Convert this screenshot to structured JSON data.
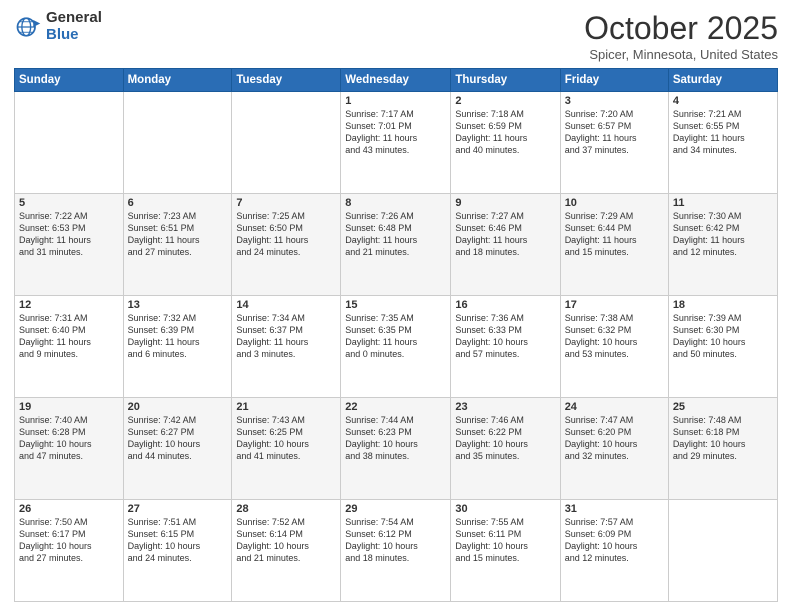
{
  "header": {
    "logo_general": "General",
    "logo_blue": "Blue",
    "title": "October 2025",
    "location": "Spicer, Minnesota, United States"
  },
  "days_of_week": [
    "Sunday",
    "Monday",
    "Tuesday",
    "Wednesday",
    "Thursday",
    "Friday",
    "Saturday"
  ],
  "weeks": [
    [
      {
        "day": "",
        "info": ""
      },
      {
        "day": "",
        "info": ""
      },
      {
        "day": "",
        "info": ""
      },
      {
        "day": "1",
        "info": "Sunrise: 7:17 AM\nSunset: 7:01 PM\nDaylight: 11 hours\nand 43 minutes."
      },
      {
        "day": "2",
        "info": "Sunrise: 7:18 AM\nSunset: 6:59 PM\nDaylight: 11 hours\nand 40 minutes."
      },
      {
        "day": "3",
        "info": "Sunrise: 7:20 AM\nSunset: 6:57 PM\nDaylight: 11 hours\nand 37 minutes."
      },
      {
        "day": "4",
        "info": "Sunrise: 7:21 AM\nSunset: 6:55 PM\nDaylight: 11 hours\nand 34 minutes."
      }
    ],
    [
      {
        "day": "5",
        "info": "Sunrise: 7:22 AM\nSunset: 6:53 PM\nDaylight: 11 hours\nand 31 minutes."
      },
      {
        "day": "6",
        "info": "Sunrise: 7:23 AM\nSunset: 6:51 PM\nDaylight: 11 hours\nand 27 minutes."
      },
      {
        "day": "7",
        "info": "Sunrise: 7:25 AM\nSunset: 6:50 PM\nDaylight: 11 hours\nand 24 minutes."
      },
      {
        "day": "8",
        "info": "Sunrise: 7:26 AM\nSunset: 6:48 PM\nDaylight: 11 hours\nand 21 minutes."
      },
      {
        "day": "9",
        "info": "Sunrise: 7:27 AM\nSunset: 6:46 PM\nDaylight: 11 hours\nand 18 minutes."
      },
      {
        "day": "10",
        "info": "Sunrise: 7:29 AM\nSunset: 6:44 PM\nDaylight: 11 hours\nand 15 minutes."
      },
      {
        "day": "11",
        "info": "Sunrise: 7:30 AM\nSunset: 6:42 PM\nDaylight: 11 hours\nand 12 minutes."
      }
    ],
    [
      {
        "day": "12",
        "info": "Sunrise: 7:31 AM\nSunset: 6:40 PM\nDaylight: 11 hours\nand 9 minutes."
      },
      {
        "day": "13",
        "info": "Sunrise: 7:32 AM\nSunset: 6:39 PM\nDaylight: 11 hours\nand 6 minutes."
      },
      {
        "day": "14",
        "info": "Sunrise: 7:34 AM\nSunset: 6:37 PM\nDaylight: 11 hours\nand 3 minutes."
      },
      {
        "day": "15",
        "info": "Sunrise: 7:35 AM\nSunset: 6:35 PM\nDaylight: 11 hours\nand 0 minutes."
      },
      {
        "day": "16",
        "info": "Sunrise: 7:36 AM\nSunset: 6:33 PM\nDaylight: 10 hours\nand 57 minutes."
      },
      {
        "day": "17",
        "info": "Sunrise: 7:38 AM\nSunset: 6:32 PM\nDaylight: 10 hours\nand 53 minutes."
      },
      {
        "day": "18",
        "info": "Sunrise: 7:39 AM\nSunset: 6:30 PM\nDaylight: 10 hours\nand 50 minutes."
      }
    ],
    [
      {
        "day": "19",
        "info": "Sunrise: 7:40 AM\nSunset: 6:28 PM\nDaylight: 10 hours\nand 47 minutes."
      },
      {
        "day": "20",
        "info": "Sunrise: 7:42 AM\nSunset: 6:27 PM\nDaylight: 10 hours\nand 44 minutes."
      },
      {
        "day": "21",
        "info": "Sunrise: 7:43 AM\nSunset: 6:25 PM\nDaylight: 10 hours\nand 41 minutes."
      },
      {
        "day": "22",
        "info": "Sunrise: 7:44 AM\nSunset: 6:23 PM\nDaylight: 10 hours\nand 38 minutes."
      },
      {
        "day": "23",
        "info": "Sunrise: 7:46 AM\nSunset: 6:22 PM\nDaylight: 10 hours\nand 35 minutes."
      },
      {
        "day": "24",
        "info": "Sunrise: 7:47 AM\nSunset: 6:20 PM\nDaylight: 10 hours\nand 32 minutes."
      },
      {
        "day": "25",
        "info": "Sunrise: 7:48 AM\nSunset: 6:18 PM\nDaylight: 10 hours\nand 29 minutes."
      }
    ],
    [
      {
        "day": "26",
        "info": "Sunrise: 7:50 AM\nSunset: 6:17 PM\nDaylight: 10 hours\nand 27 minutes."
      },
      {
        "day": "27",
        "info": "Sunrise: 7:51 AM\nSunset: 6:15 PM\nDaylight: 10 hours\nand 24 minutes."
      },
      {
        "day": "28",
        "info": "Sunrise: 7:52 AM\nSunset: 6:14 PM\nDaylight: 10 hours\nand 21 minutes."
      },
      {
        "day": "29",
        "info": "Sunrise: 7:54 AM\nSunset: 6:12 PM\nDaylight: 10 hours\nand 18 minutes."
      },
      {
        "day": "30",
        "info": "Sunrise: 7:55 AM\nSunset: 6:11 PM\nDaylight: 10 hours\nand 15 minutes."
      },
      {
        "day": "31",
        "info": "Sunrise: 7:57 AM\nSunset: 6:09 PM\nDaylight: 10 hours\nand 12 minutes."
      },
      {
        "day": "",
        "info": ""
      }
    ]
  ]
}
